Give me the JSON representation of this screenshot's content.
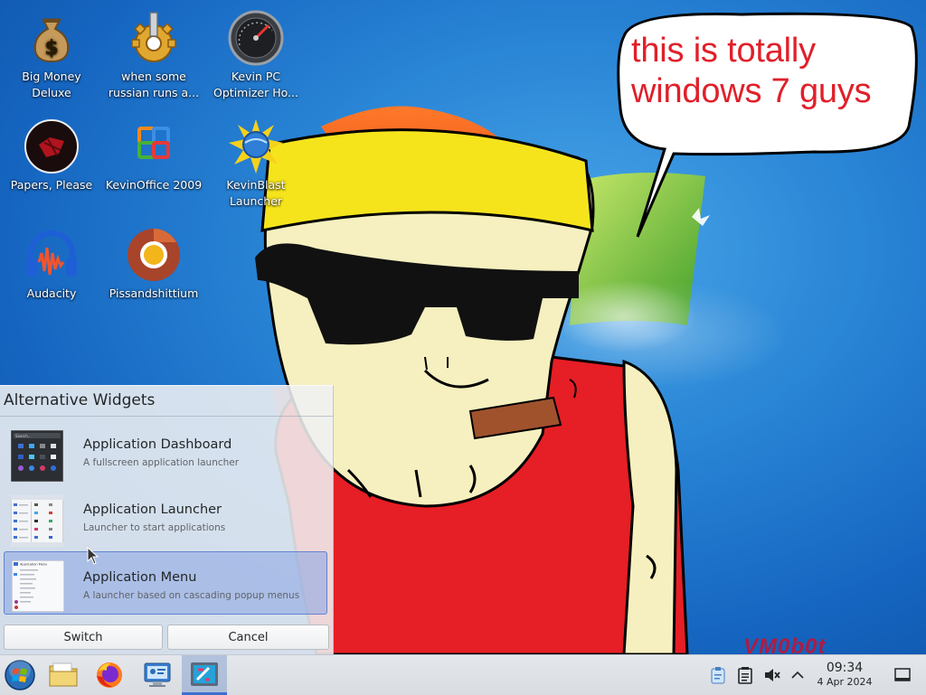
{
  "desktop": {
    "icons": [
      {
        "label": "Big Money Deluxe",
        "icon": "money-bag-icon"
      },
      {
        "label": "when some russian runs a...",
        "icon": "gear-icon"
      },
      {
        "label": "Kevin PC Optimizer Ho...",
        "icon": "speedometer-icon"
      },
      {
        "label": "Papers, Please",
        "icon": "papers-please-icon"
      },
      {
        "label": "KevinOffice 2009",
        "icon": "office-icon"
      },
      {
        "label": "KevinBlast Launcher",
        "icon": "globe-burst-icon"
      },
      {
        "label": "Audacity",
        "icon": "audacity-headphones-icon"
      },
      {
        "label": "Pissandshittium",
        "icon": "browser-icon"
      }
    ],
    "speech_bubble": "this is totally windows 7 guys",
    "watermark": "VM0b0t"
  },
  "widget_panel": {
    "title": "Alternative Widgets",
    "items": [
      {
        "name": "Application Dashboard",
        "description": "A fullscreen application launcher",
        "selected": false
      },
      {
        "name": "Application Launcher",
        "description": "Launcher to start applications",
        "selected": false
      },
      {
        "name": "Application Menu",
        "description": "A launcher based on cascading popup menus",
        "selected": true
      }
    ],
    "dashboard_search": "Search...",
    "menu_thumb_heading": "Application Menu",
    "switch_label": "Switch",
    "cancel_label": "Cancel"
  },
  "taskbar": {
    "items": [
      "start-orb-icon",
      "file-manager-icon",
      "firefox-icon",
      "system-settings-icon",
      "active-window-icon"
    ],
    "tray": [
      "clipboard-icon",
      "notes-icon",
      "volume-muted-icon",
      "chevron-up-icon"
    ],
    "clock_time": "09:34",
    "clock_date": "4 Apr 2024",
    "show_desktop": "show-desktop-icon"
  },
  "colors": {
    "bubble_text": "#e0202a",
    "selection": "#8fa8e2",
    "wallpaper": "#1e78d0"
  }
}
